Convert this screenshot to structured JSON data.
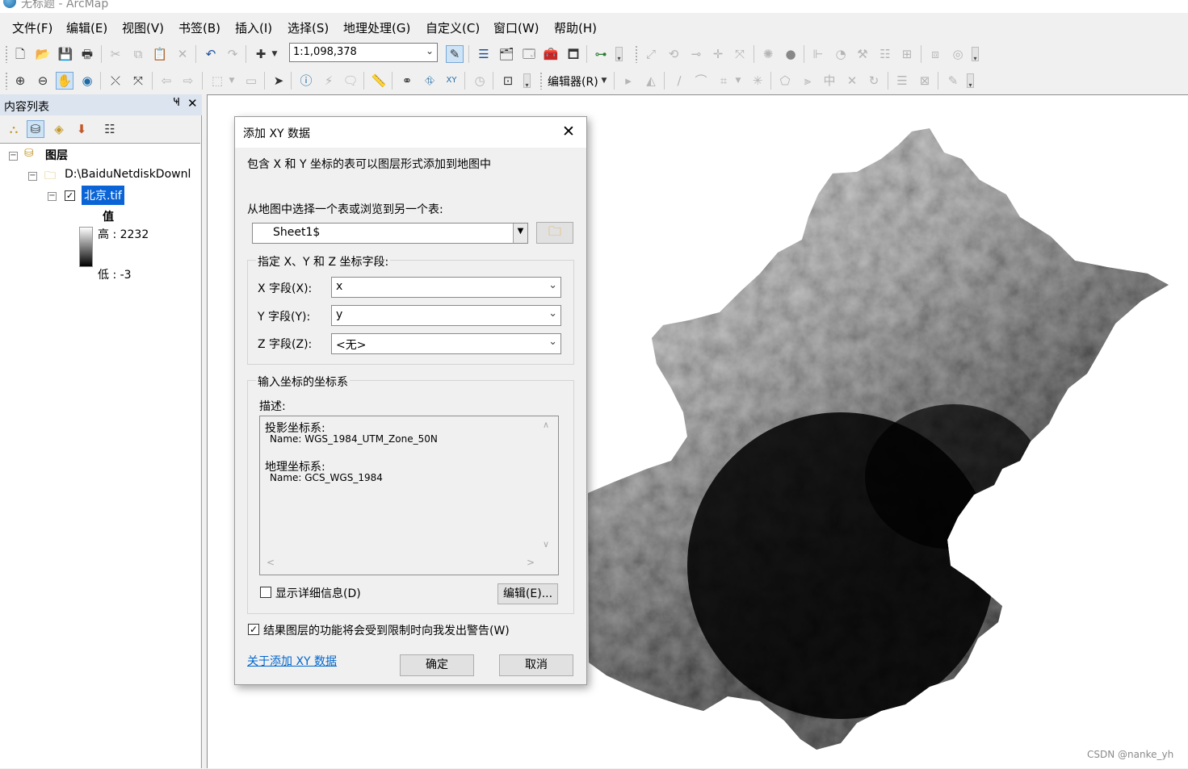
{
  "window": {
    "title": "无标题 - ArcMap"
  },
  "menubar": {
    "items": [
      "文件(F)",
      "编辑(E)",
      "视图(V)",
      "书签(B)",
      "插入(I)",
      "选择(S)",
      "地理处理(G)",
      "自定义(C)",
      "窗口(W)",
      "帮助(H)"
    ]
  },
  "toolbar": {
    "scale_value": "1:1,098,378",
    "editor_label": "编辑器(R)"
  },
  "toc": {
    "title": "内容列表",
    "pin_glyph": "Ҹ",
    "close_glyph": "✕",
    "layers_root": "图层",
    "folder_path": "D:\\BaiduNetdiskDownl",
    "layer_name": "北京.tif",
    "layer_checked": true,
    "legend_value_label": "值",
    "legend_high": "高 : 2232",
    "legend_low": "低 : -3"
  },
  "dialog": {
    "title": "添加 XY 数据",
    "close_glyph": "✕",
    "intro": "包含 X 和 Y 坐标的表可以图层形式添加到地图中",
    "table_prompt": "从地图中选择一个表或浏览到另一个表:",
    "table_value": "Sheet1$",
    "fields_group_label": "指定 X、Y 和 Z 坐标字段:",
    "x_label": "X 字段(X):",
    "x_value": "x",
    "y_label": "Y 字段(Y):",
    "y_value": "y",
    "z_label": "Z 字段(Z):",
    "z_value": "<无>",
    "crs_group_label": "输入坐标的坐标系",
    "description_label": "描述:",
    "description_lines": [
      "投影坐标系:",
      "Name: WGS_1984_UTM_Zone_50N",
      "地理坐标系:",
      "Name: GCS_WGS_1984"
    ],
    "show_details_label": "显示详细信息(D)",
    "show_details_checked": false,
    "edit_button": "编辑(E)...",
    "warn_label": "结果图层的功能将会受到限制时向我发出警告(W)",
    "warn_checked": true,
    "about_link": "关于添加 XY 数据",
    "ok_button": "确定",
    "cancel_button": "取消"
  },
  "watermark": "CSDN @nanke_yh",
  "colors": {
    "selection": "#0a64d6",
    "toc_header": "#dbe4ef",
    "link": "#0066cc",
    "dialog_bg": "#f0f0f0"
  },
  "icons": {
    "open_folder_button": "open-folder-icon",
    "scale_dropdown": "chevron-down-icon",
    "dialog_close": "close-icon"
  }
}
